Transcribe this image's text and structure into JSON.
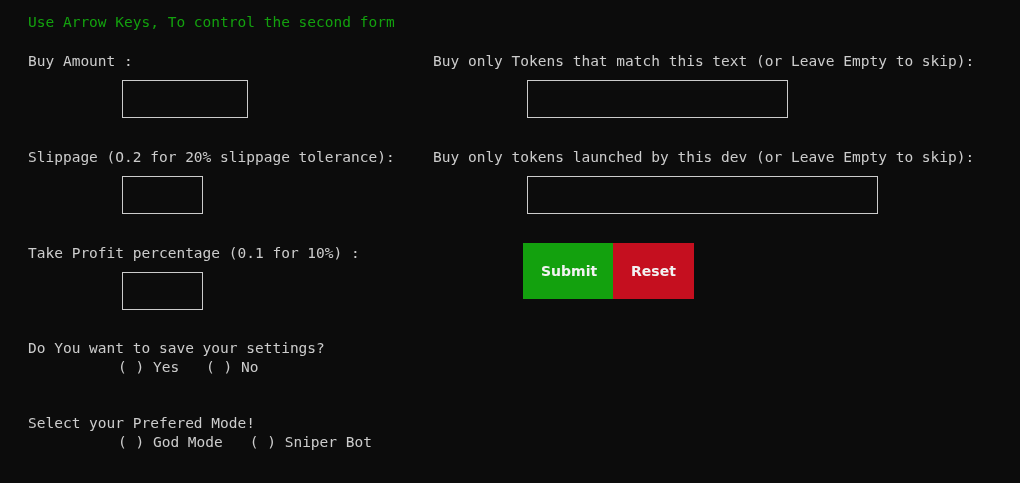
{
  "hint": "Use Arrow Keys, To control the second form",
  "left_fields": [
    {
      "label": "Buy Amount :"
    },
    {
      "label": "Slippage (O.2 for 20% slippage tolerance):"
    },
    {
      "label": "Take Profit percentage (0.1 for 10%) :"
    }
  ],
  "right_fields": [
    {
      "label": "Buy only Tokens that match this text (or Leave Empty to skip):"
    },
    {
      "label": "Buy only tokens launched by this dev (or Leave Empty to skip):"
    }
  ],
  "buttons": [
    {
      "label": "Submit",
      "kind": "submit"
    },
    {
      "label": "Reset",
      "kind": "reset"
    }
  ],
  "questions": [
    {
      "label": "Do You want to save your settings?",
      "options": [
        {
          "marker": "( )",
          "label": "Yes",
          "selected": false
        },
        {
          "marker": "( )",
          "label": "No",
          "selected": false
        }
      ]
    },
    {
      "label": "Select your Prefered Mode!",
      "options": [
        {
          "marker": "( )",
          "label": "God Mode",
          "selected": false
        },
        {
          "marker": "( )",
          "label": "Sniper Bot",
          "selected": false
        }
      ]
    }
  ]
}
